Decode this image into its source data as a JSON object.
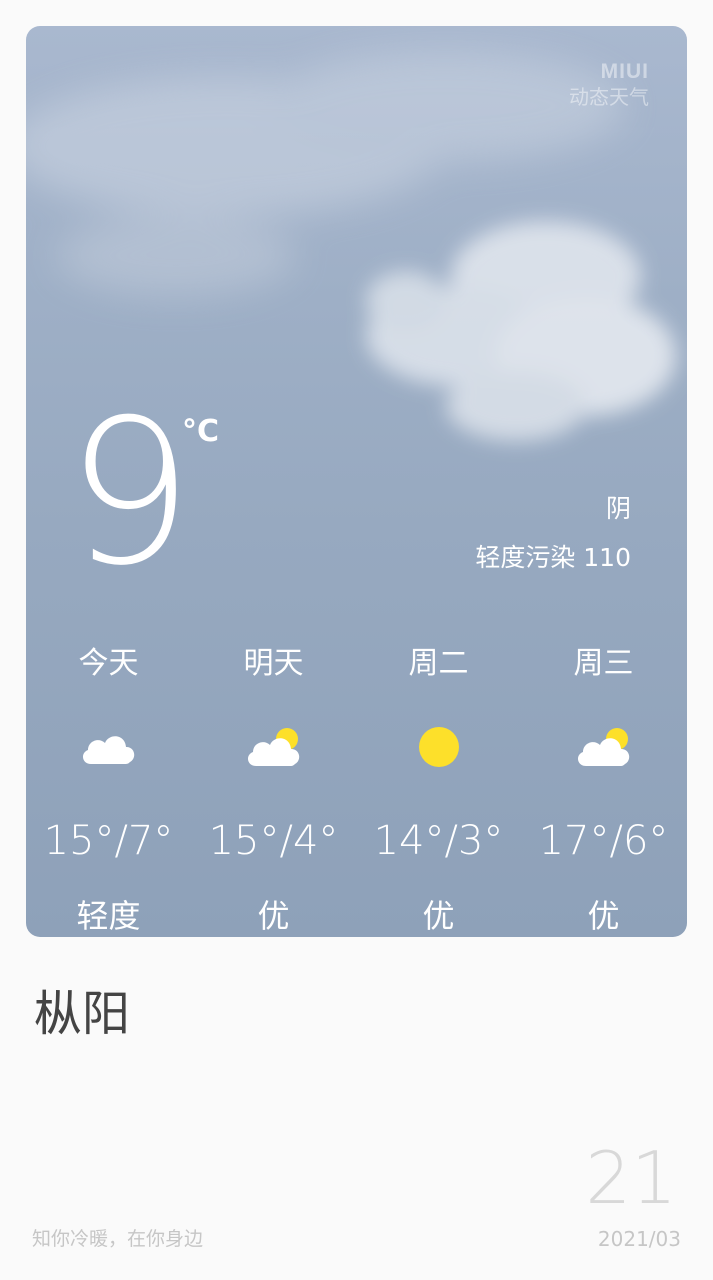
{
  "brand": {
    "name": "MIUI",
    "subtitle": "动态天气"
  },
  "current": {
    "temperature": "9",
    "unit": "°C",
    "condition": "阴",
    "air_quality": "轻度污染 110"
  },
  "forecast": [
    {
      "day": "今天",
      "icon": "cloudy-icon",
      "range": "15°/7°",
      "air": "轻度"
    },
    {
      "day": "明天",
      "icon": "partly-cloudy-icon",
      "range": "15°/4°",
      "air": "优"
    },
    {
      "day": "周二",
      "icon": "sunny-icon",
      "range": "14°/3°",
      "air": "优"
    },
    {
      "day": "周三",
      "icon": "partly-cloudy-icon",
      "range": "17°/6°",
      "air": "优"
    }
  ],
  "city": "枞阳",
  "date": {
    "day": "21",
    "year_month": "2021/03"
  },
  "slogan": "知你冷暖，在你身边",
  "colors": {
    "sun": "#fde02a",
    "cloud": "#ffffff",
    "card_top": "#a9b8cf",
    "card_bottom": "#8ea1b9"
  }
}
